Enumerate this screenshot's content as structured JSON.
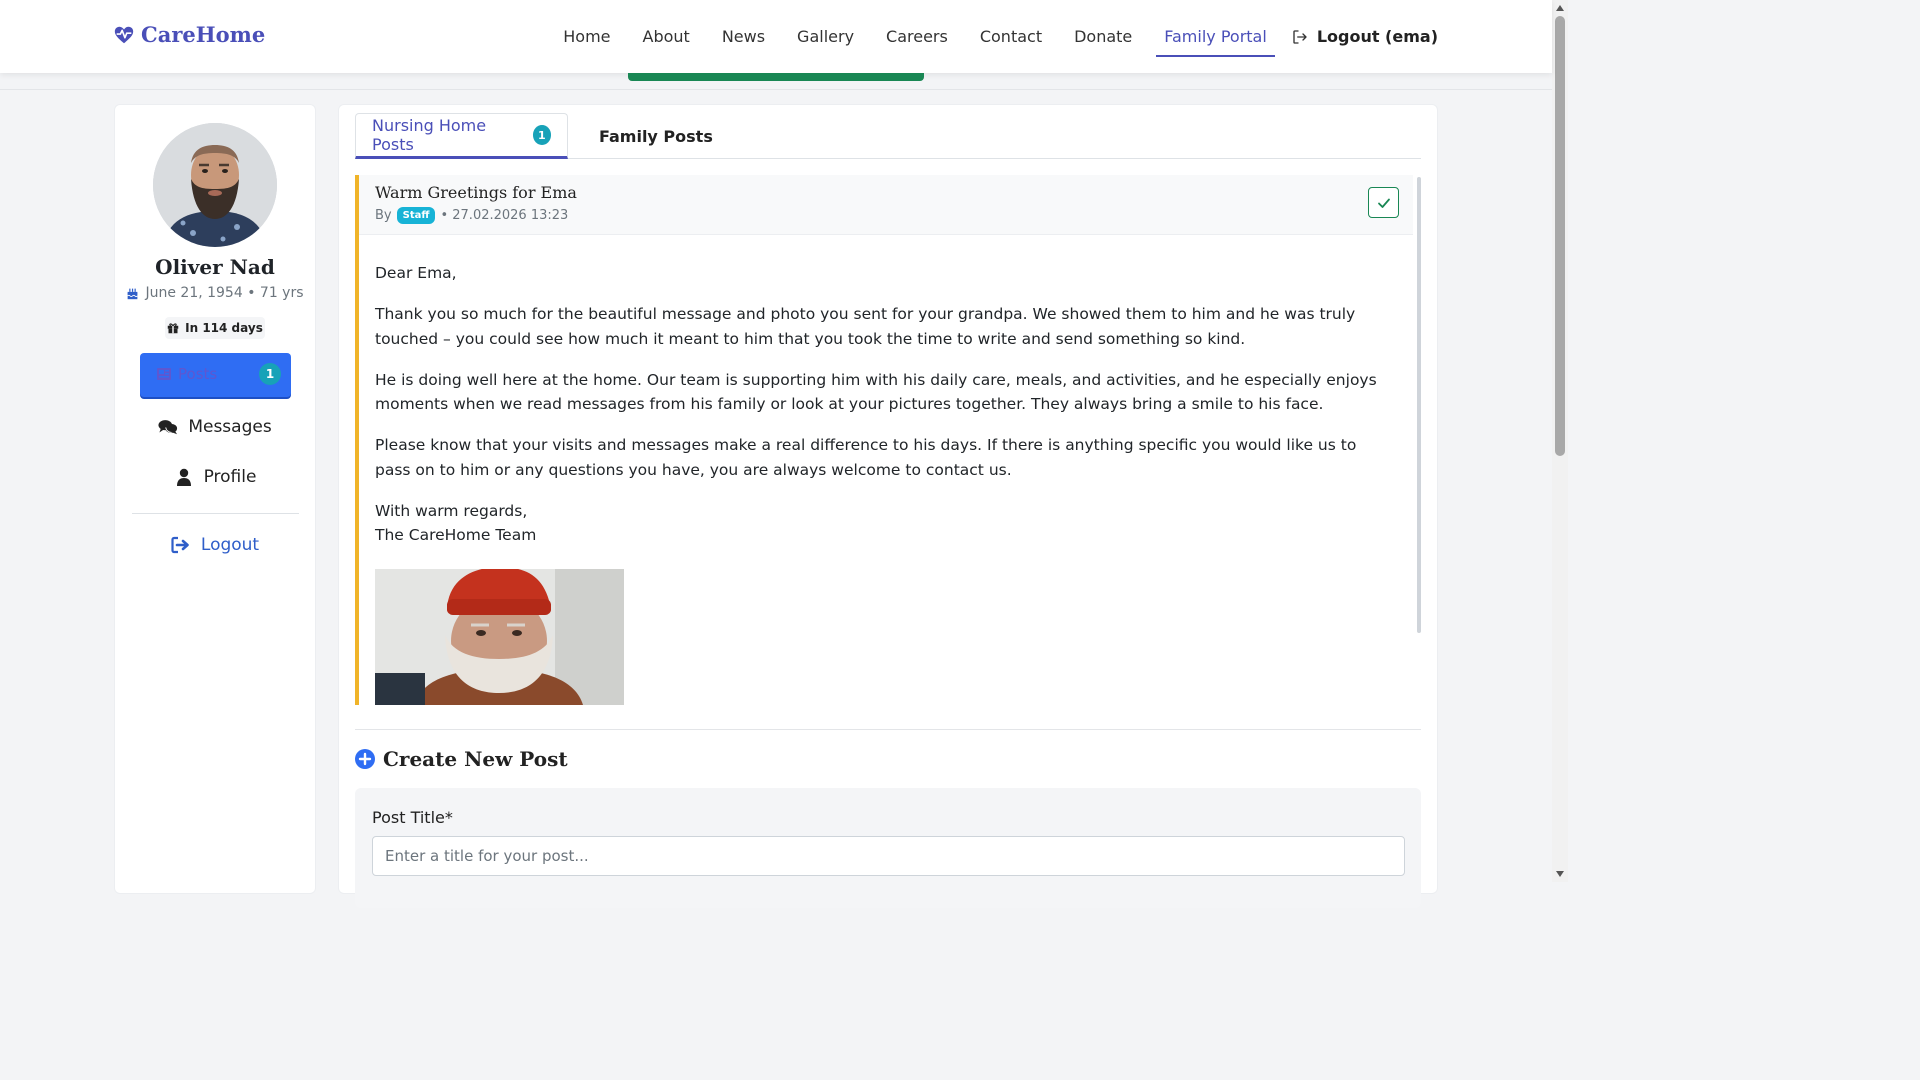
{
  "brand": {
    "name": "CareHome",
    "color": "#4a4fb8"
  },
  "nav": {
    "items": [
      "Home",
      "About",
      "News",
      "Gallery",
      "Careers",
      "Contact",
      "Donate",
      "Family Portal"
    ],
    "active": "Family Portal",
    "logout_label": "Logout (ema)"
  },
  "resident": {
    "name": "Oliver Nad",
    "dob": "June 21, 1954 • 71 yrs",
    "birthday": "In 114 days"
  },
  "sidebar": {
    "posts_label": "Posts",
    "posts_count": "1",
    "messages_label": "Messages",
    "profile_label": "Profile",
    "logout_label": "Logout"
  },
  "tabs": {
    "nursing": "Nursing Home Posts",
    "nursing_count": "1",
    "family": "Family Posts"
  },
  "post": {
    "title": "Warm Greetings for Ema",
    "by": "By",
    "author_badge": "Staff",
    "date": "• 27.02.2026 13:23",
    "greeting": "Dear Ema,",
    "p1": "Thank you so much for the beautiful message and photo you sent for your grandpa. We showed them to him and he was truly touched – you could see how much it meant to him that you took the time to write and send something so kind.",
    "p2": "He is doing well here at the home. Our team is supporting him with his daily care, meals, and activities, and he especially enjoys moments when we read messages from his family or look at your pictures together. They always bring a smile to his face.",
    "p3": "Please know that your visits and messages make a real difference to his days. If there is anything specific you would like us to pass on to him or any questions you have, you are always welcome to contact us.",
    "sign1": "With warm regards,",
    "sign2": "The CareHome Team"
  },
  "create": {
    "title": "Create New Post",
    "label": "Post Title*",
    "placeholder": "Enter a title for your post..."
  }
}
